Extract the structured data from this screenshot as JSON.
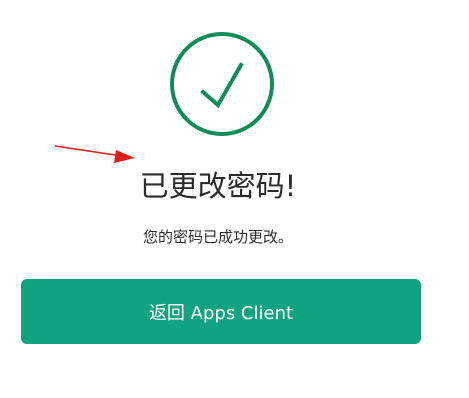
{
  "title": "已更改密码!",
  "message": "您的密码已成功更改。",
  "button": {
    "label": "返回 Apps Client"
  },
  "icons": {
    "success": "check-circle-icon",
    "annotation": "red-arrow-icon"
  },
  "colors": {
    "accent": "#10a37f",
    "icon": "#118b57",
    "annotation": "#e11b1b",
    "text": "#2b2b2b"
  }
}
